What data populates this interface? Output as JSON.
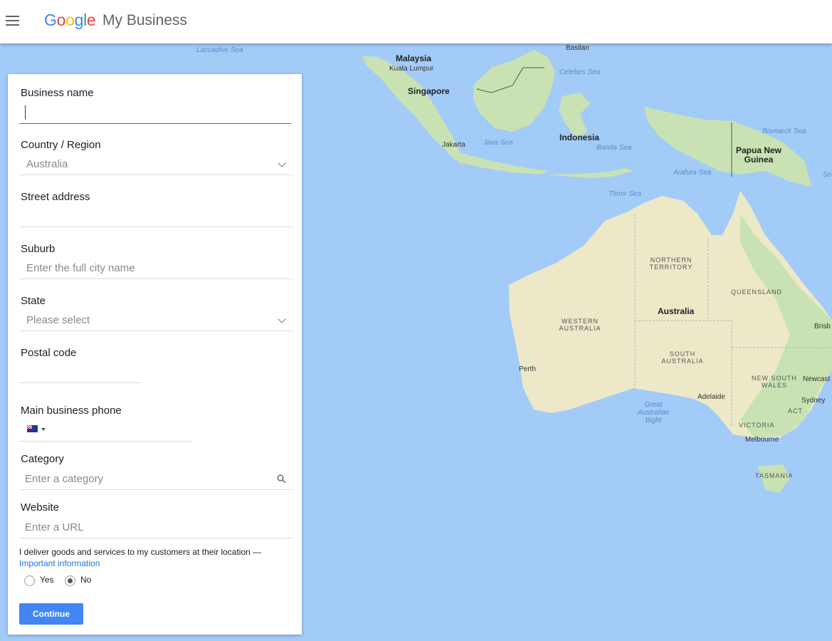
{
  "header": {
    "logo_letters": [
      "G",
      "o",
      "o",
      "g",
      "l",
      "e"
    ],
    "app_name": "My Business"
  },
  "form": {
    "business_name": {
      "label": "Business name",
      "value": ""
    },
    "country": {
      "label": "Country / Region",
      "value": "Australia"
    },
    "street": {
      "label": "Street address",
      "value": ""
    },
    "suburb": {
      "label": "Suburb",
      "placeholder": "Enter the full city name"
    },
    "state": {
      "label": "State",
      "placeholder": "Please select"
    },
    "postal": {
      "label": "Postal code",
      "value": ""
    },
    "phone": {
      "label": "Main business phone",
      "flag": "australia-flag-icon"
    },
    "category": {
      "label": "Category",
      "placeholder": "Enter a category"
    },
    "website": {
      "label": "Website",
      "placeholder": "Enter a URL"
    },
    "delivery": {
      "text": "I deliver goods and services to my customers at their location —",
      "link": "Important information",
      "options": [
        "Yes",
        "No"
      ],
      "selected": "No"
    },
    "continue_label": "Continue"
  },
  "map": {
    "labels": {
      "laccadive": "Laccadive Sea",
      "basilan": "Basilan",
      "malaysia": "Malaysia",
      "kuala_lumpur": "Kuala Lumpur",
      "celebes": "Celebes Sea",
      "singapore": "Singapore",
      "indonesia": "Indonesia",
      "jakarta": "Jakarta",
      "java_sea": "Java Sea",
      "banda_sea": "Banda Sea",
      "bismarck": "Bismarck Sea",
      "png": "Papua New Guinea",
      "arafura": "Arafura Sea",
      "timor": "Timor Sea",
      "so": "So",
      "nt": "NORTHERN TERRITORY",
      "qld": "QUEENSLAND",
      "australia": "Australia",
      "brisb": "Brisb",
      "wa": "WESTERN AUSTRALIA",
      "sa": "SOUTH AUSTRALIA",
      "perth": "Perth",
      "nsw": "NEW SOUTH WALES",
      "newcastle": "Newcast",
      "sydney": "Sydney",
      "adelaide": "Adelaide",
      "act": "ACT",
      "bight": "Great Australian Bight",
      "vic": "VICTORIA",
      "melbourne": "Melbourne",
      "tas": "TASMANIA"
    },
    "colors": {
      "water": "#a3cbf8",
      "land": "#c9e2b3",
      "land_dry": "#ede8c8"
    }
  }
}
